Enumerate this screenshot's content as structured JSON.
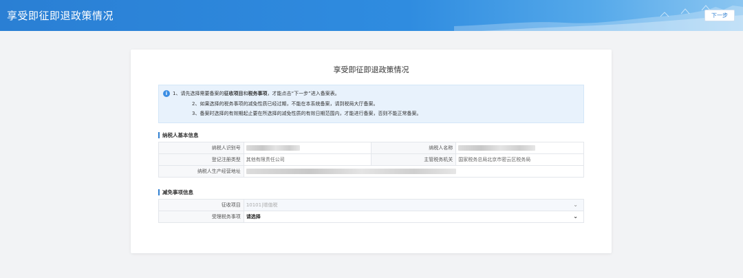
{
  "header": {
    "title": "享受即征即退政策情况",
    "next_label": "下一步"
  },
  "card": {
    "title": "享受即征即退政策情况"
  },
  "notice": {
    "line1_pre": "1、请先选择需要备案的",
    "line1_bold1": "征收项目",
    "line1_mid": "和",
    "line1_bold2": "税务事项",
    "line1_post": "，才能点击“下一步”进入备案表。",
    "line2": "2、如果选择的税务事项的减免性质已经过期，不能在本系统备案，请到税局大厅备案。",
    "line3": "3、备案时选择的有效期起止要在所选择的减免性质的有效日期范围内，才能进行备案，否则不能正常备案。"
  },
  "taxpayer_section": {
    "title": "纳税人基本信息",
    "id_label": "纳税人识别号",
    "name_label": "纳税人名称",
    "reg_type_label": "登记注册类型",
    "reg_type_value": "其他有限责任公司",
    "tax_office_label": "主管税务机关",
    "tax_office_value": "国家税务总局北京市密云区税务局",
    "address_label": "纳税人生产经营地址"
  },
  "relief_section": {
    "title": "减免事项信息",
    "levy_item_label": "征收项目",
    "levy_item_value": "10101|增值税",
    "tax_matter_label": "受理税务事项",
    "tax_matter_value": "请选择"
  },
  "colors": {
    "header_blue": "#2a7fd4",
    "accent": "#2f7fd1",
    "notice_bg": "#e8f2fc"
  }
}
